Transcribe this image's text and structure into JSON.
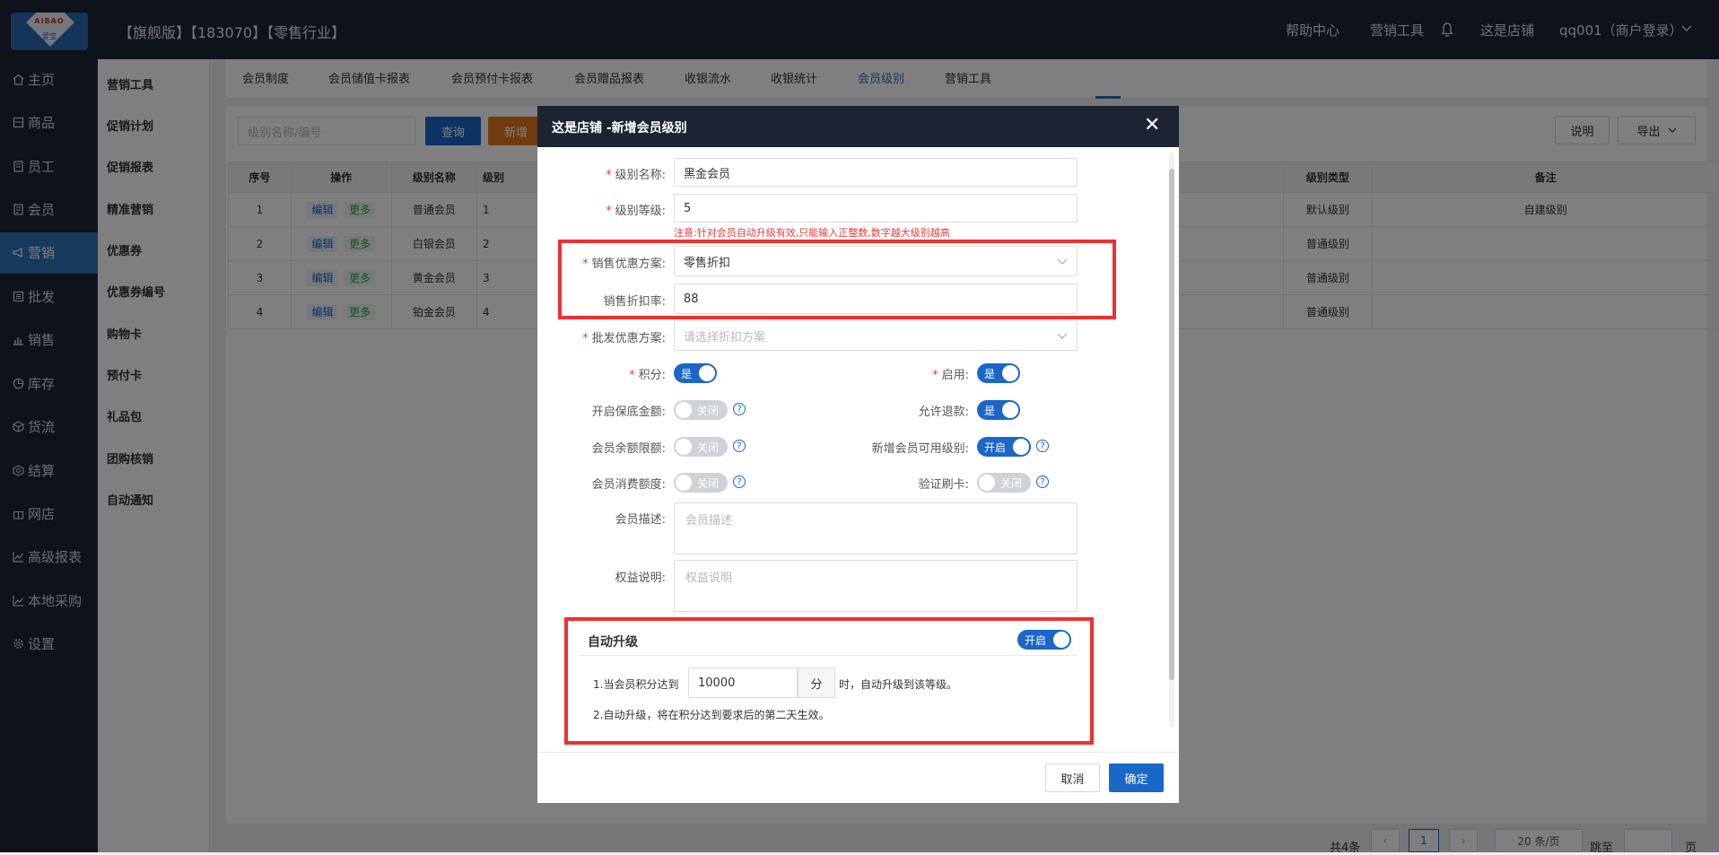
{
  "topbar": {
    "logo_top": "AIBAO",
    "logo_bottom": "爱宝",
    "brand": "【旗舰版】【183070】【零售行业】",
    "help": "帮助中心",
    "marketing_tools": "营销工具",
    "store": "这是店铺",
    "user": "qq001（商户登录）"
  },
  "sidebar": [
    "主页",
    "商品",
    "员工",
    "会员",
    "营销",
    "批发",
    "销售",
    "库存",
    "货流",
    "结算",
    "网店",
    "高级报表",
    "本地采购",
    "设置"
  ],
  "subnav": [
    "营销工具",
    "促销计划",
    "促销报表",
    "精准营销",
    "优惠券",
    "优惠券编号",
    "购物卡",
    "预付卡",
    "礼品包",
    "团购核销",
    "自动通知"
  ],
  "tabs": [
    "会员制度",
    "会员储值卡报表",
    "会员预付卡报表",
    "会员赠品报表",
    "收银流水",
    "收银统计",
    "会员级别",
    "营销工具"
  ],
  "toolbar": {
    "search_placeholder": "级别名称/编号",
    "query": "查询",
    "add": "新增",
    "explain": "说明",
    "export": "导出"
  },
  "table": {
    "headers": [
      "序号",
      "操作",
      "级别名称",
      "级别",
      "级别类型",
      "备注"
    ],
    "edit": "编辑",
    "more": "更多",
    "rows": [
      {
        "no": "1",
        "name": "普通会员",
        "level": "1",
        "type": "默认级别",
        "note": "自建级别"
      },
      {
        "no": "2",
        "name": "白银会员",
        "level": "2",
        "type": "普通级别",
        "note": ""
      },
      {
        "no": "3",
        "name": "黄金会员",
        "level": "3",
        "type": "普通级别",
        "note": ""
      },
      {
        "no": "4",
        "name": "铂金会员",
        "level": "4",
        "type": "普通级别",
        "note": ""
      }
    ]
  },
  "pagination": {
    "total": "共4条",
    "page": "1",
    "page_size": "20 条/页",
    "goto": "跳至",
    "unit": "页"
  },
  "modal": {
    "title": "这是店铺 -新增会员级别",
    "level_name_label": "级别名称:",
    "level_name": "黑金会员",
    "level_rank_label": "级别等级:",
    "level_rank": "5",
    "hint": "注意:针对会员自动升级有效,只能输入正整数,数字越大级别越高",
    "sale_scheme_label": "销售优惠方案:",
    "sale_scheme": "零售折扣",
    "sale_rate_label": "销售折扣率:",
    "sale_rate": "88",
    "wholesale_label": "批发优惠方案:",
    "wholesale_placeholder": "请选择折扣方案",
    "points_label": "积分:",
    "enable_label": "启用:",
    "floor_label": "开启保底金额:",
    "refund_label": "允许退款:",
    "balance_label": "会员余额限额:",
    "new_member_label": "新增会员可用级别:",
    "spend_label": "会员消费额度:",
    "verify_label": "验证刷卡:",
    "on_yes": "是",
    "off": "关闭",
    "on_open": "开启",
    "desc_label": "会员描述:",
    "desc_placeholder": "会员描述",
    "rights_label": "权益说明:",
    "rights_placeholder": "权益说明",
    "auto_title": "自动升级",
    "auto_line1_a": "1.当会员积分达到",
    "auto_points": "10000",
    "auto_unit": "分",
    "auto_line1_b": "时，自动升级到该等级。",
    "auto_line2": "2.自动升级，将在积分达到要求后的第二天生效。",
    "cancel": "取消",
    "confirm": "确定"
  }
}
